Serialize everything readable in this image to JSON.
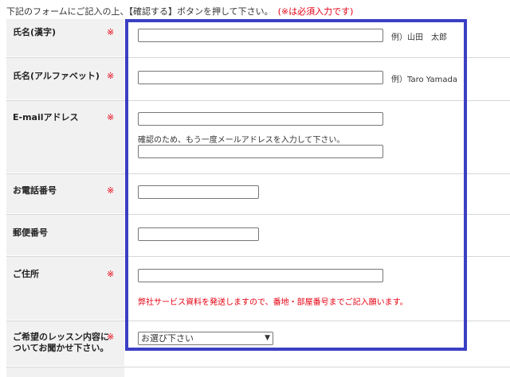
{
  "intro": {
    "text": "下記のフォームにご記入の上、【確認する】ボタンを押して下さい。",
    "required_note": "(※は必須入力です)"
  },
  "required_mark": "※",
  "fields": {
    "name_kanji": {
      "label": "氏名(漢字)",
      "value": "",
      "example": "例）山田　太郎"
    },
    "name_alpha": {
      "label": "氏名(アルファベット)",
      "value": "",
      "example": "例）Taro Yamada"
    },
    "email": {
      "label": "E-mailアドレス",
      "value": "",
      "confirm_hint": "確認のため、もう一度メールアドレスを入力して下さい。",
      "confirm_value": ""
    },
    "phone": {
      "label": "お電話番号",
      "value": ""
    },
    "postal": {
      "label": "郵便番号",
      "value": ""
    },
    "address": {
      "label": "ご住所",
      "value": "",
      "hint": "弊社サービス資料を発送しますので、番地・部屋番号までご記入願います。"
    },
    "lesson": {
      "label_line1": "ご希望のレッスン内容に",
      "label_line2": "ついてお聞かせ下さい。",
      "selected": "お選び下さい"
    }
  },
  "colors": {
    "required": "#e60012",
    "highlight_frame": "#3b3fc4",
    "label_bg": "#f1f1f1"
  },
  "icons": {
    "select_arrow": "chevron-down-icon"
  }
}
